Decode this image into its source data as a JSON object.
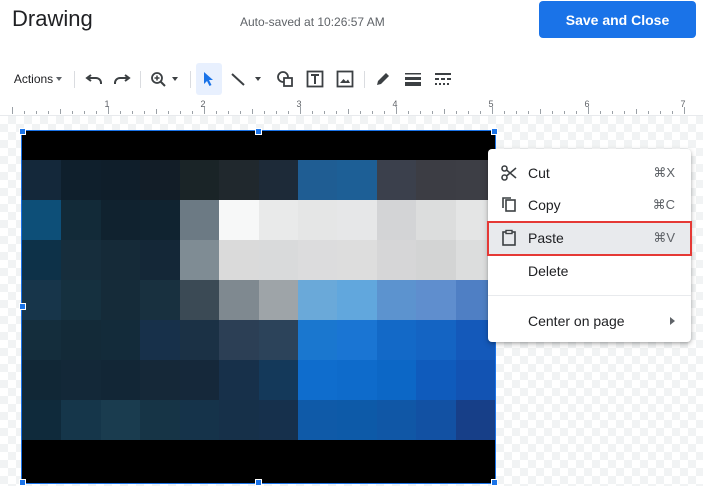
{
  "header": {
    "title": "Drawing",
    "autosave_text": "Auto-saved at 10:26:57 AM",
    "save_button_label": "Save and Close"
  },
  "toolbar": {
    "actions_label": "Actions",
    "tools": [
      "undo-icon",
      "redo-icon",
      "zoom-icon",
      "select-icon",
      "line-icon",
      "shape-icon",
      "textbox-icon",
      "image-icon",
      "pen-icon",
      "line-weight-icon",
      "line-dash-icon"
    ]
  },
  "ruler": {
    "labels": [
      "1",
      "2",
      "3",
      "4",
      "5",
      "6",
      "7"
    ]
  },
  "image": {
    "description_colors": [
      [
        "#14283a",
        "#0f1f2c",
        "#0f1e2a",
        "#121d27",
        "#1a2427",
        "#20282d",
        "#1d2a38",
        "#1f5d93",
        "#1d5f96",
        "#3b404c",
        "#3c3d44",
        "#3d3e45"
      ],
      [
        "#0d4f78",
        "#122a38",
        "#10222f",
        "#102330",
        "#6c7a84",
        "#f7f8f8",
        "#e9eaea",
        "#e5e6e6",
        "#e6e7e8",
        "#d3d4d6",
        "#dcdddd",
        "#e4e5e5"
      ],
      [
        "#0d3148",
        "#162d3c",
        "#152a38",
        "#142737",
        "#7f8c94",
        "#dadada",
        "#d9dadb",
        "#dcdcdd",
        "#dddddd",
        "#d6d6d7",
        "#d3d4d4",
        "#dcdddd"
      ],
      [
        "#17354a",
        "#15303f",
        "#152b39",
        "#18303f",
        "#3b4a55",
        "#7f8990",
        "#9ea4a8",
        "#6aa9d9",
        "#61a7dd",
        "#5c93cf",
        "#5f8ece",
        "#4f7fc4"
      ],
      [
        "#142d3c",
        "#132a38",
        "#132b3a",
        "#17304a",
        "#1b3145",
        "#2c3f55",
        "#2c435a",
        "#1a77cf",
        "#1a75d3",
        "#1369c7",
        "#1464c3",
        "#1459ba"
      ],
      [
        "#112736",
        "#132838",
        "#122636",
        "#152838",
        "#15283a",
        "#17304a",
        "#14395a",
        "#0f6dcd",
        "#0e6bcb",
        "#0c67c6",
        "#0f5bbc",
        "#1253b3"
      ],
      [
        "#0f2a3b",
        "#15364a",
        "#1a3c4f",
        "#163446",
        "#15334a",
        "#163049",
        "#16304c",
        "#0f5aa8",
        "#0d5aa8",
        "#1057a6",
        "#1251a3",
        "#173f88"
      ]
    ]
  },
  "context_menu": {
    "items": [
      {
        "label": "Cut",
        "shortcut": "⌘X",
        "icon": "scissors-icon"
      },
      {
        "label": "Copy",
        "shortcut": "⌘C",
        "icon": "copy-icon"
      },
      {
        "label": "Paste",
        "shortcut": "⌘V",
        "icon": "clipboard-icon",
        "highlighted": true
      },
      {
        "label": "Delete",
        "shortcut": "",
        "icon": ""
      }
    ],
    "center_label": "Center on page"
  }
}
